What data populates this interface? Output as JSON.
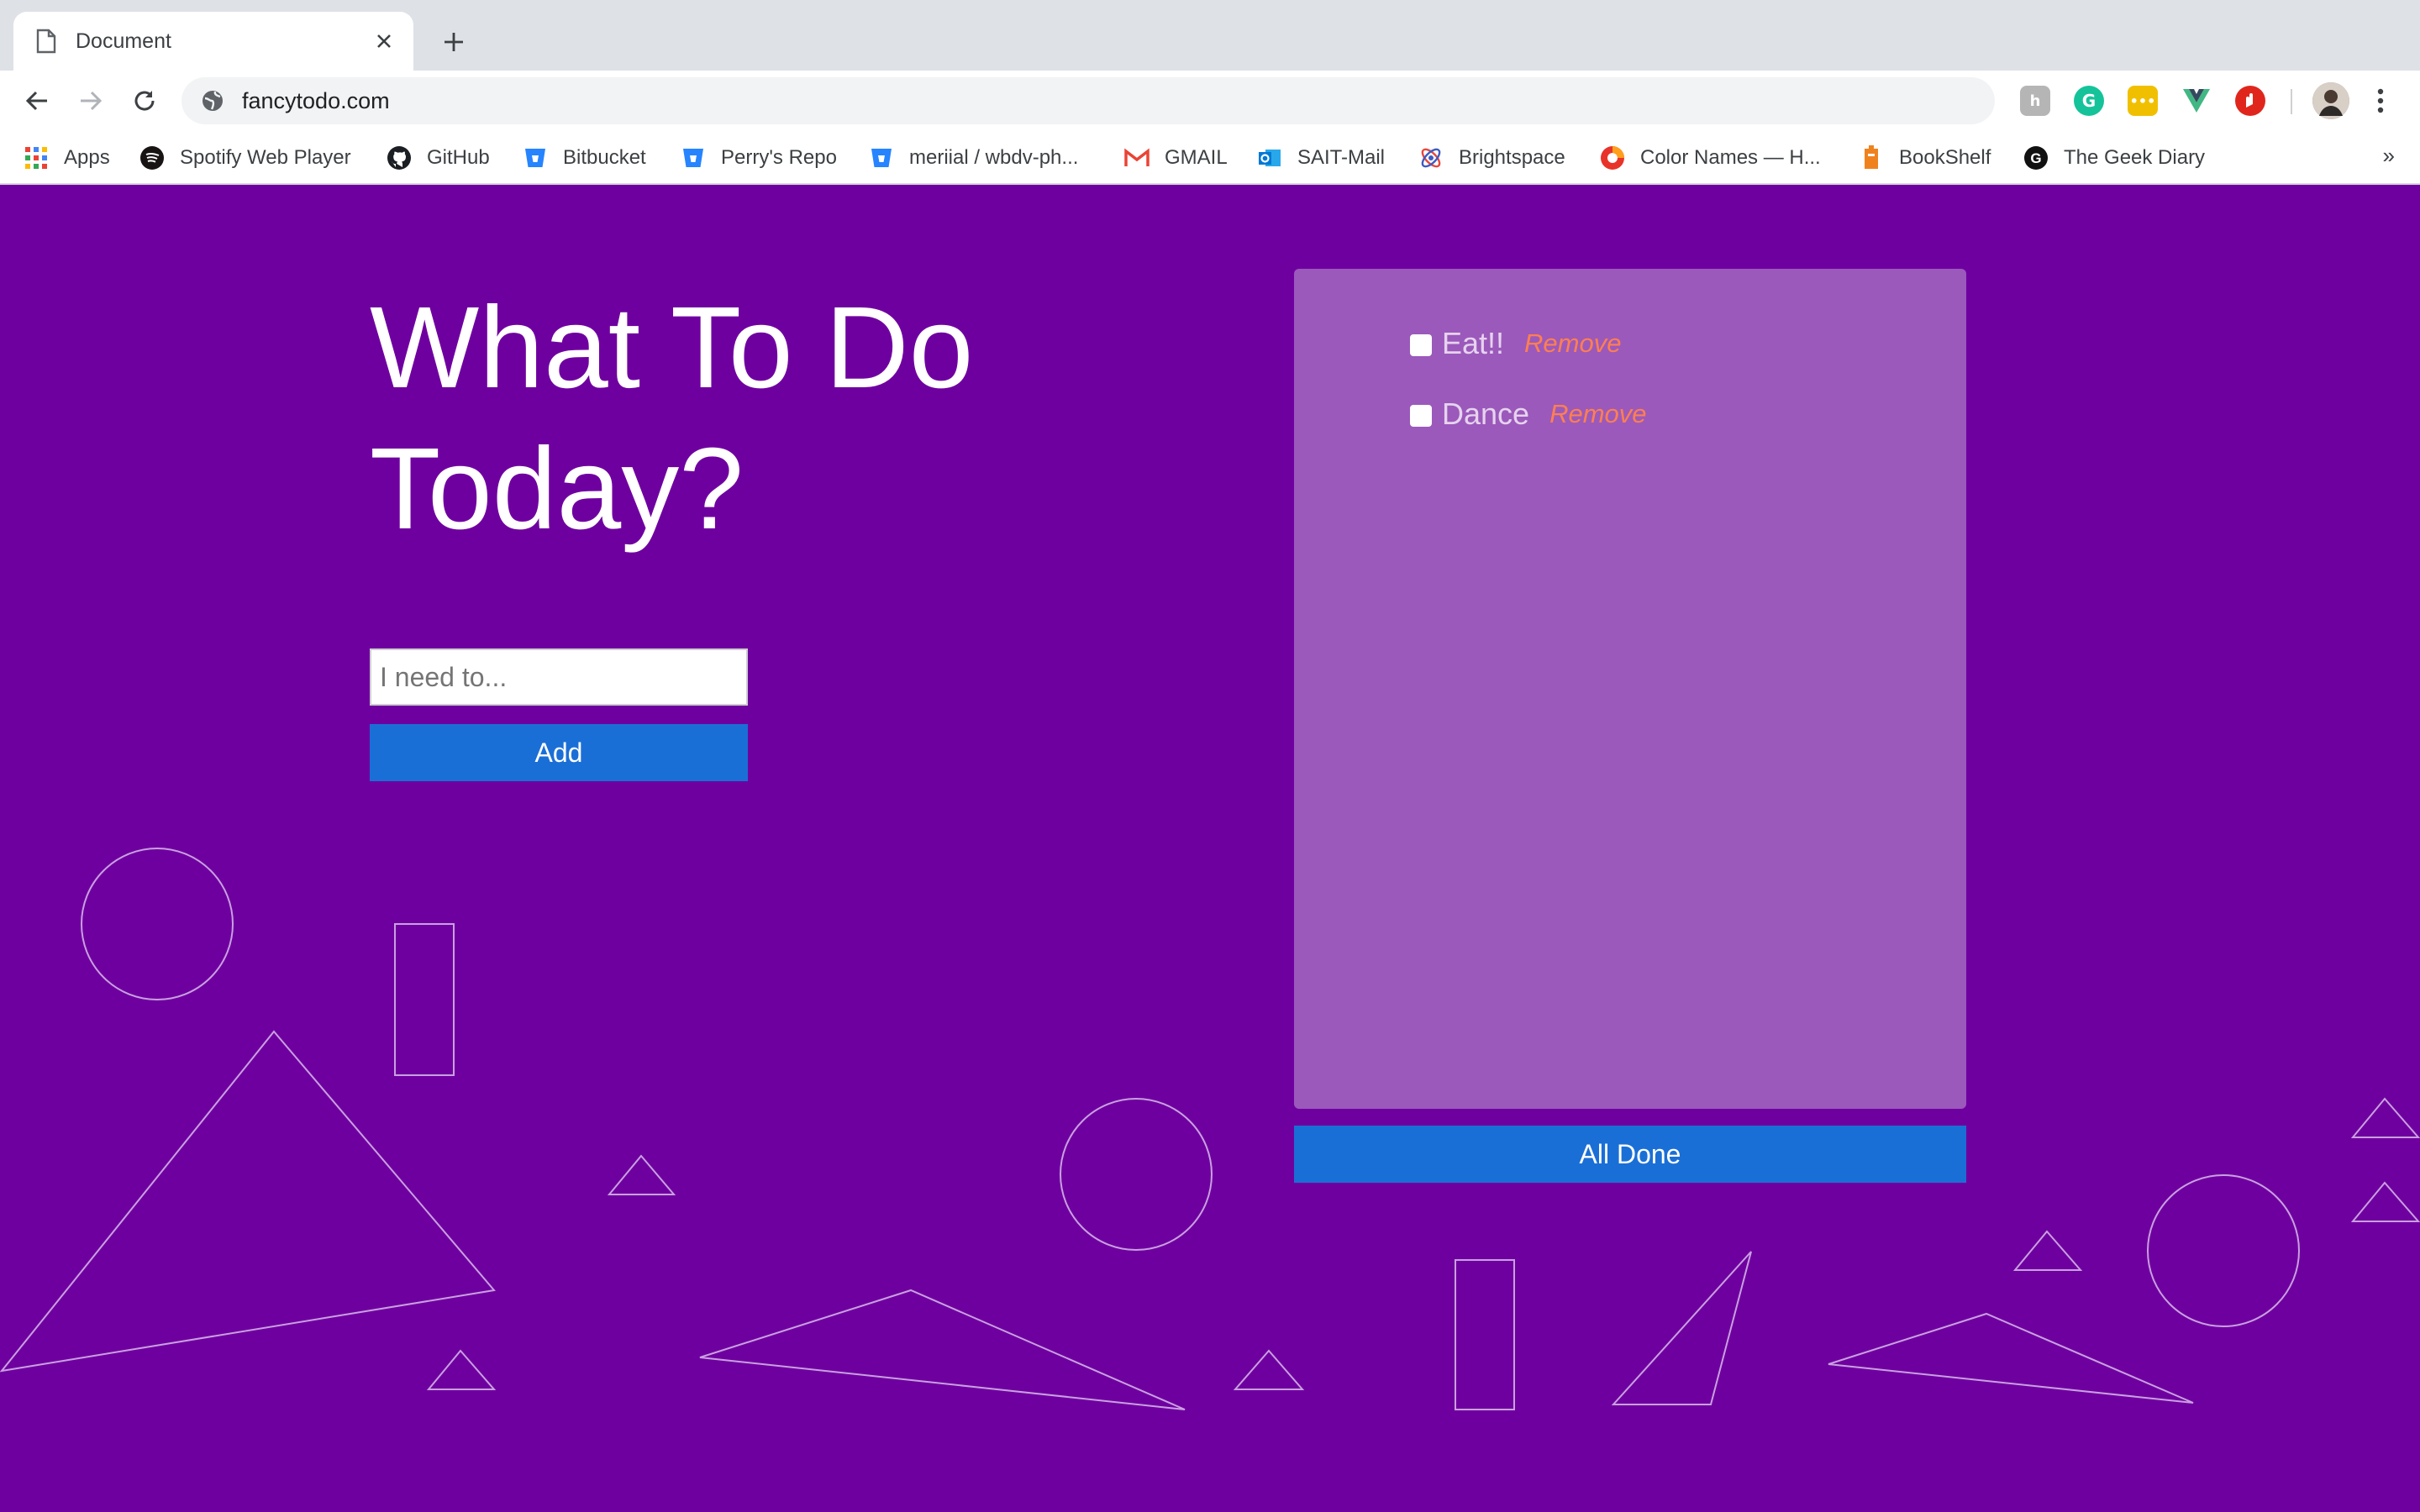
{
  "browser": {
    "tab": {
      "title": "Document"
    },
    "url": "fancytodo.com",
    "bookmarks": [
      {
        "label": "Apps",
        "icon": "apps-grid-icon"
      },
      {
        "label": "Spotify Web Player",
        "icon": "spotify-icon"
      },
      {
        "label": "GitHub",
        "icon": "github-icon"
      },
      {
        "label": "Bitbucket",
        "icon": "bitbucket-icon"
      },
      {
        "label": "Perry's Repo",
        "icon": "bitbucket-icon"
      },
      {
        "label": "meriial / wbdv-ph...",
        "icon": "bitbucket-icon"
      },
      {
        "label": "GMAIL",
        "icon": "gmail-icon"
      },
      {
        "label": "SAIT-Mail",
        "icon": "outlook-icon"
      },
      {
        "label": "Brightspace",
        "icon": "brightspace-icon"
      },
      {
        "label": "Color Names — H...",
        "icon": "color-names-icon"
      },
      {
        "label": "BookShelf",
        "icon": "bookshelf-icon"
      },
      {
        "label": "The Geek Diary",
        "icon": "geek-diary-icon"
      }
    ],
    "more_bookmarks": "»"
  },
  "page": {
    "heading_line1": "What To Do",
    "heading_line2": "Today?",
    "input_placeholder": "I need to...",
    "add_label": "Add",
    "todos": [
      {
        "text": "Eat!!",
        "remove_label": "Remove",
        "checked": false
      },
      {
        "text": "Dance",
        "remove_label": "Remove",
        "checked": false
      }
    ],
    "all_done_label": "All Done"
  },
  "colors": {
    "background": "#6f00a0",
    "panel": "#9b59bb",
    "button": "#1a6fd6",
    "remove": "#ff7f50"
  }
}
